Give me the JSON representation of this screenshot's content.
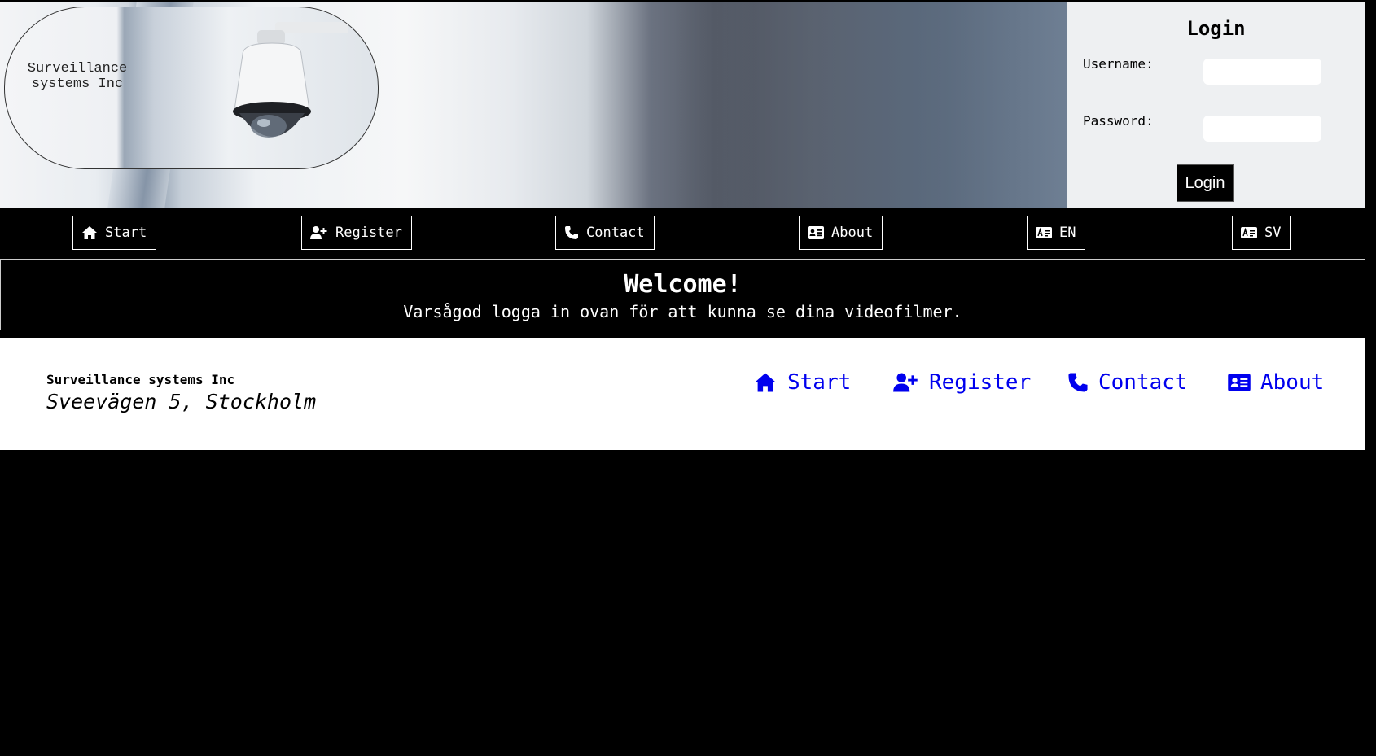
{
  "brand": {
    "logo_text": "Surveillance\nsystems Inc"
  },
  "login": {
    "title": "Login",
    "username_label": "Username:",
    "password_label": "Password:",
    "button_label": "Login"
  },
  "nav": {
    "items": [
      {
        "label": "Start",
        "icon": "home-icon"
      },
      {
        "label": "Register",
        "icon": "user-plus-icon"
      },
      {
        "label": "Contact",
        "icon": "phone-icon"
      },
      {
        "label": "About",
        "icon": "id-card-icon"
      },
      {
        "label": "EN",
        "icon": "language-icon"
      },
      {
        "label": "SV",
        "icon": "language-icon"
      }
    ]
  },
  "welcome": {
    "title": "Welcome!",
    "text": "Varsågod logga in ovan för att kunna se dina videofilmer."
  },
  "footer": {
    "company": "Surveillance systems Inc",
    "address": "Sveevägen 5, Stockholm",
    "links": [
      {
        "label": "Start",
        "icon": "home-icon"
      },
      {
        "label": "Register",
        "icon": "user-plus-icon"
      },
      {
        "label": "Contact",
        "icon": "phone-icon"
      },
      {
        "label": "About",
        "icon": "id-card-icon"
      }
    ]
  },
  "colors": {
    "link": "#0000ee",
    "background": "#000000",
    "login_panel": "#eef0f2"
  }
}
